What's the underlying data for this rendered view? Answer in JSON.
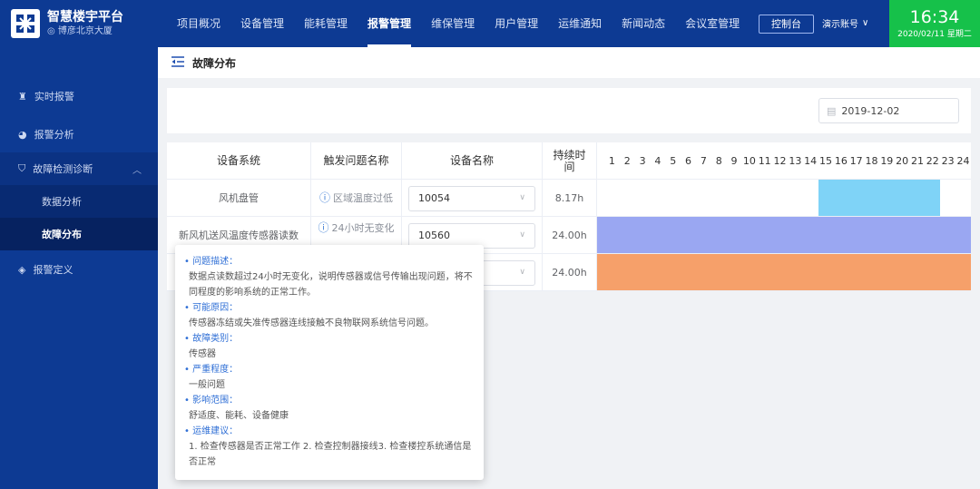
{
  "header": {
    "app_name": "智慧楼宇平台",
    "location": "博彦北京大厦",
    "nav": [
      "项目概况",
      "设备管理",
      "能耗管理",
      "报警管理",
      "维保管理",
      "用户管理",
      "运维通知",
      "新闻动态",
      "会议室管理"
    ],
    "active_nav": "报警管理",
    "console_label": "控制台",
    "account_label": "演示账号",
    "time": "16:34",
    "date": "2020/02/11 星期二"
  },
  "sidebar": {
    "items": [
      {
        "label": "实时报警",
        "icon": "alarm-icon"
      },
      {
        "label": "报警分析",
        "icon": "pie-icon"
      },
      {
        "label": "故障检测诊断",
        "icon": "shield-icon"
      },
      {
        "label": "数据分析"
      },
      {
        "label": "故障分布"
      },
      {
        "label": "报警定义",
        "icon": "tag-icon"
      }
    ]
  },
  "page": {
    "breadcrumb": "故障分布",
    "date_value": "2019-12-02"
  },
  "table": {
    "headers": [
      "设备系统",
      "触发问题名称",
      "设备名称",
      "持续时间"
    ],
    "hours": [
      "1",
      "2",
      "3",
      "4",
      "5",
      "6",
      "7",
      "8",
      "9",
      "10",
      "11",
      "12",
      "13",
      "14",
      "15",
      "16",
      "17",
      "18",
      "19",
      "20",
      "21",
      "22",
      "23",
      "24"
    ],
    "rows": [
      {
        "system": "风机盘管",
        "issue": "区域温度过低",
        "device": "10054",
        "duration": "8.17h",
        "bar_start_hour": 14,
        "bar_end_hour": 22,
        "bar_color": "#7fd3f7"
      },
      {
        "system": "新风机送风温度传感器读数",
        "issue": "24小时无变化",
        "device": "10560",
        "duration": "24.00h",
        "bar_start_hour": 0,
        "bar_end_hour": 24,
        "bar_color": "#9aa7f2"
      },
      {
        "system": "",
        "issue": "",
        "device": "",
        "duration": "24.00h",
        "bar_start_hour": 0,
        "bar_end_hour": 24,
        "bar_color": "#f6a06a"
      }
    ]
  },
  "tooltip": {
    "sections": [
      {
        "key": "问题描述：",
        "value": "数据点读数超过24小时无变化，说明传感器或信号传输出现问题，将不同程度的影响系统的正常工作。"
      },
      {
        "key": "可能原因：",
        "value": "传感器冻结或失准传感器连线接触不良物联网系统信号问题。"
      },
      {
        "key": "故障类别：",
        "value": "传感器"
      },
      {
        "key": "严重程度：",
        "value": "一般问题"
      },
      {
        "key": "影响范围：",
        "value": "舒适度、能耗、设备健康"
      },
      {
        "key": "运维建议：",
        "value": "1. 检查传感器是否正常工作 2. 检查控制器接线3. 检查楼控系统通信是否正常"
      }
    ]
  }
}
